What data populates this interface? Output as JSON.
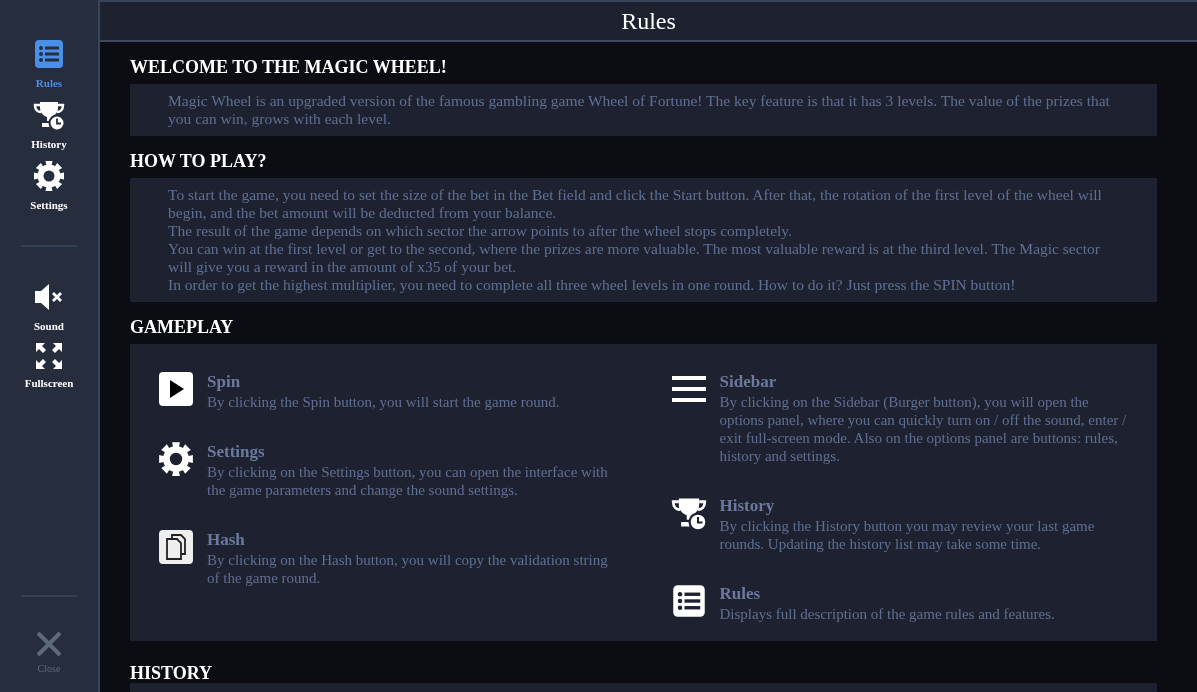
{
  "sidebar": {
    "nav_items": [
      {
        "kind": "rules",
        "label": "Rules",
        "selected": true
      },
      {
        "kind": "history",
        "label": "History",
        "selected": false
      },
      {
        "kind": "settings",
        "label": "Settings",
        "selected": false
      }
    ],
    "toggles": [
      {
        "kind": "sound",
        "label": "Sound",
        "muted": true
      },
      {
        "kind": "fullscreen",
        "label": "Fullscreen"
      }
    ],
    "close": {
      "label": "Close"
    }
  },
  "window": {
    "title": "Rules"
  },
  "sections": [
    {
      "kind": "text",
      "heading": "WELCOME TO THE MAGIC WHEEL!",
      "paragraphs": [
        "Magic Wheel is an upgraded version of the famous gambling game Wheel of Fortune! The key feature is that it has 3 levels. The value of the prizes that you can win, grows with each level."
      ]
    },
    {
      "kind": "text",
      "heading": "HOW TO PLAY?",
      "paragraphs": [
        "To start the game, you need to set the size of the bet in the Bet field and click the Start button. After that, the rotation of the first level of the wheel will begin, and the bet amount will be deducted from your balance.",
        "The result of the game depends on which sector the arrow points to after the wheel stops completely.",
        "You can win at the first level or get to the second, where the prizes are more valuable. The most valuable reward is at the third level. The Magic sector will give you a reward in the amount of x35 of your bet.",
        "In order to get the highest multiplier, you need to complete all three wheel levels in one round. How to do it? Just press the SPIN button!"
      ]
    },
    {
      "kind": "gameplay",
      "heading": "GAMEPLAY",
      "columns": [
        [
          {
            "kind": "spin",
            "title": "Spin",
            "text": "By clicking the Spin button, you will start the game round."
          },
          {
            "kind": "settings",
            "title": "Settings",
            "text": "By clicking on the Settings button, you can open the interface with the game parameters and change the sound settings."
          },
          {
            "kind": "hash",
            "title": "Hash",
            "text": "By clicking on the Hash button, you will copy the validation string of the game round."
          }
        ],
        [
          {
            "kind": "sidebar",
            "title": "Sidebar",
            "text": "By clicking on the Sidebar (Burger button), you will open the options panel, where you can quickly turn on / off the sound, enter / exit full-screen mode. Also on the options panel are buttons: rules, history and settings."
          },
          {
            "kind": "history",
            "title": "History",
            "text": "By clicking the History button you may review your last game rounds. Updating the history list may take some time."
          },
          {
            "kind": "rules",
            "title": "Rules",
            "text": "Displays full description of the game rules and features."
          }
        ]
      ]
    },
    {
      "kind": "cut",
      "heading": "HISTORY"
    }
  ]
}
